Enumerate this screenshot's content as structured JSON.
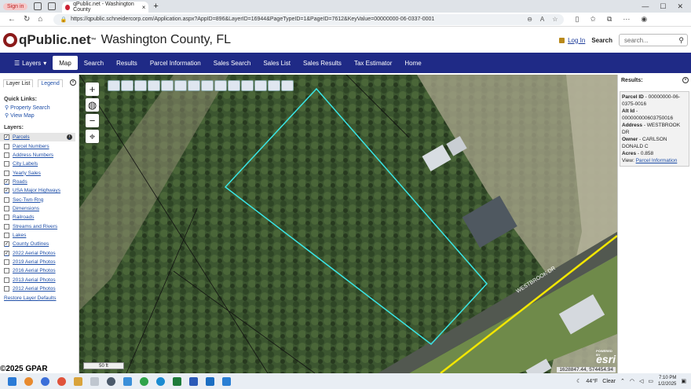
{
  "browser": {
    "signin_label": "Sign in",
    "tab_title": "qPublic.net - Washington County",
    "url": "https://qpublic.schneidercorp.com/Application.aspx?AppID=896&LayerID=16944&PageTypeID=1&PageID=7612&KeyValue=00000000-06-0337-0001"
  },
  "header": {
    "logo_text": "qPublic.net",
    "logo_tm": "™",
    "county": "Washington County, FL",
    "login_label": "Log In",
    "search_label": "Search",
    "search_placeholder": "search..."
  },
  "nav": [
    {
      "label": "Layers",
      "active": false
    },
    {
      "label": "Map",
      "active": true
    },
    {
      "label": "Search",
      "active": false
    },
    {
      "label": "Results",
      "active": false
    },
    {
      "label": "Parcel Information",
      "active": false
    },
    {
      "label": "Sales Search",
      "active": false
    },
    {
      "label": "Sales List",
      "active": false
    },
    {
      "label": "Sales Results",
      "active": false
    },
    {
      "label": "Tax Estimator",
      "active": false
    },
    {
      "label": "Home",
      "active": false
    }
  ],
  "sidebar": {
    "tab_layer_list": "Layer List",
    "tab_legend": "Legend",
    "quick_links_title": "Quick Links:",
    "quick_links": [
      "Property Search",
      "View Map"
    ],
    "layers_title": "Layers:",
    "layers": [
      {
        "label": "Parcels",
        "checked": true,
        "selected": true
      },
      {
        "label": "Parcel Numbers",
        "checked": false
      },
      {
        "label": "Address Numbers",
        "checked": false
      },
      {
        "label": "City Labels",
        "checked": false
      },
      {
        "label": "Yearly Sales",
        "checked": false
      },
      {
        "label": "Roads",
        "checked": true
      },
      {
        "label": "USA Major Highways",
        "checked": true
      },
      {
        "label": "Sec-Twn-Rng",
        "checked": false
      },
      {
        "label": "Dimensions",
        "checked": false
      },
      {
        "label": "Railroads",
        "checked": false
      },
      {
        "label": "Streams and Rivers",
        "checked": false
      },
      {
        "label": "Lakes",
        "checked": false
      },
      {
        "label": "County Outlines",
        "checked": true
      },
      {
        "label": "2022 Aerial Photos",
        "checked": true
      },
      {
        "label": "2019 Aerial Photos",
        "checked": false
      },
      {
        "label": "2016 Aerial Photos",
        "checked": false
      },
      {
        "label": "2013 Aerial Photos",
        "checked": false
      },
      {
        "label": "2012 Aerial Photos",
        "checked": false
      }
    ],
    "restore_label": "Restore Layer Defaults",
    "copyright": "©2025 GPAR"
  },
  "map": {
    "scale_label": "50 ft",
    "road_label": "WESTBROOK DR",
    "coords": "1628847.44, 574454.94",
    "esri_label": "esri",
    "esri_powered": "POWERED BY"
  },
  "results": {
    "title": "Results:",
    "parcel_id_label": "Parcel ID",
    "parcel_id": "00000000-06-0375-0016",
    "alt_id_label": "Alt Id",
    "alt_id": "000000000603750016",
    "address_label": "Address",
    "address": "WESTBROOK DR",
    "owner_label": "Owner",
    "owner": "CARLSON DONALD C",
    "acres_label": "Acres",
    "acres": "0.858",
    "view_label": "View:",
    "view_link": "Parcel Information"
  },
  "taskbar": {
    "weather_temp": "44°F",
    "weather_desc": "Clear",
    "time": "7:10 PM",
    "date": "1/2/2025"
  },
  "colors": {
    "nav_bg": "#1f2a86",
    "parcel_outline": "#39e6e6",
    "road_yellow": "#f2e600"
  }
}
